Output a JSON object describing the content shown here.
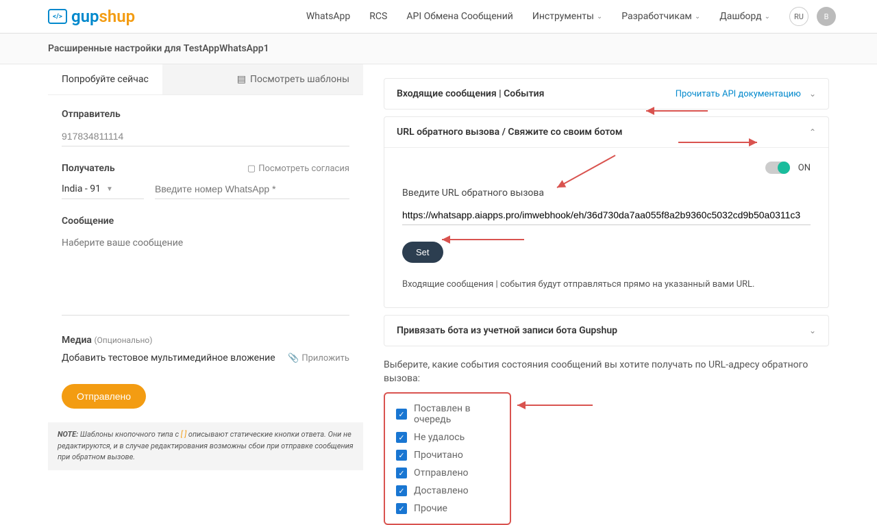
{
  "header": {
    "logo_gup": "gup",
    "logo_shup": "shup",
    "nav": [
      "WhatsApp",
      "RCS",
      "API Обмена Сообщений",
      "Инструменты",
      "Разработчикам",
      "Дашборд"
    ],
    "lang": "RU",
    "avatar": "B"
  },
  "subheader": "Расширенные настройки для TestAppWhatsApp1",
  "left": {
    "tabs": {
      "try": "Попробуйте сейчас",
      "templates": "Посмотреть шаблоны"
    },
    "sender_label": "Отправитель",
    "sender_value": "917834811114",
    "recipient_label": "Получатель",
    "view_consents": "Посмотреть согласия",
    "country": "India - 91",
    "recipient_placeholder": "Введите номер WhatsApp *",
    "message_label": "Сообщение",
    "message_placeholder": "Наберите ваше сообщение",
    "media_label": "Медиа",
    "media_optional": "(Опционально)",
    "media_add": "Добавить тестовое мультимедийное вложение",
    "attach": "Приложить",
    "send": "Отправлено",
    "note_prefix": "NOTE:",
    "note_text": " Шаблоны кнопочного типа с ",
    "note_br1": "[",
    "note_br2": "]",
    "note_text2": " описывают статические кнопки ответа. Они не редактируются, и в случае редактирования возможны сбои при отправке сообщения при обратном вызове."
  },
  "right": {
    "acc1": {
      "title": "Входящие сообщения | События",
      "link": "Прочитать API документацию"
    },
    "acc2": {
      "title": "URL обратного вызова / Свяжите со своим ботом",
      "toggle": "ON",
      "hint": "Введите URL обратного вызова",
      "url": "https://whatsapp.aiapps.pro/imwebhook/eh/36d730da7aa055f8a2b9360c5032cd9b50a0311c3",
      "set": "Set",
      "info": "Входящие сообщения | события будут отправляться прямо на указанный вами URL."
    },
    "acc3": {
      "title": "Привязать бота из учетной записи бота Gupshup"
    },
    "events_label": "Выберите, какие события состояния сообщений вы хотите получать по URL-адресу обратного вызова:",
    "events": [
      "Поставлен в очередь",
      "Не удалось",
      "Прочитано",
      "Отправлено",
      "Доставлено",
      "Прочие"
    ]
  }
}
